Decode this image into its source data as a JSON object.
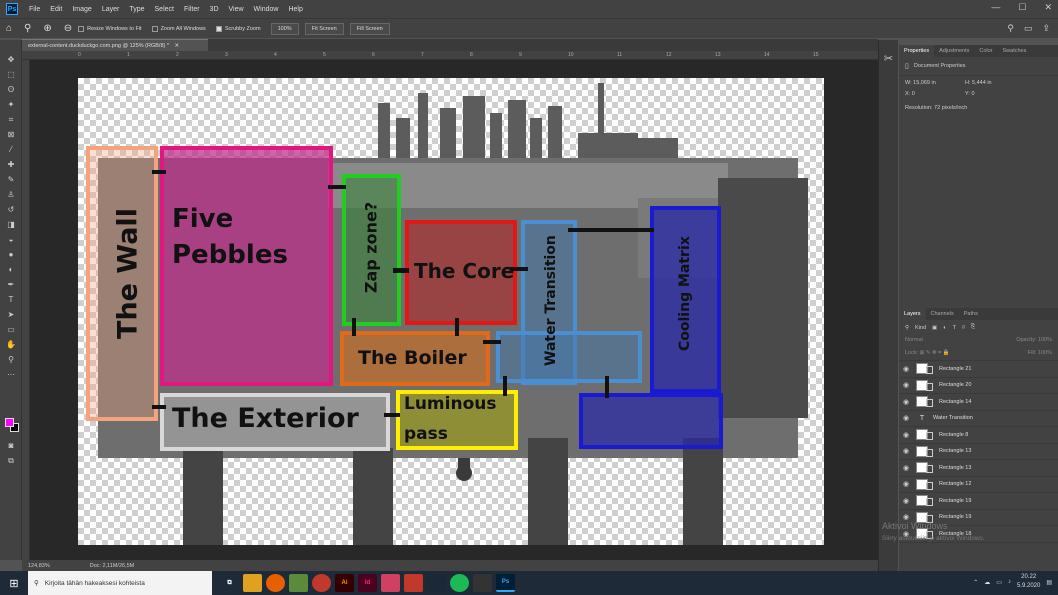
{
  "menubar": {
    "logo": "Ps",
    "items": [
      "File",
      "Edit",
      "Image",
      "Layer",
      "Type",
      "Select",
      "Filter",
      "3D",
      "View",
      "Window",
      "Help"
    ]
  },
  "options": {
    "resize_windows": "Resize Windows to Fit",
    "zoom_all": "Zoom All Windows",
    "scrubby_zoom": "Scrubby Zoom",
    "zoom_pct_btn": "100%",
    "fit_screen": "Fit Screen",
    "fill_screen": "Fill Screen"
  },
  "document": {
    "tab_title": "external-content.duckduckgo.com.png @ 125% (RGB/8) *"
  },
  "ruler": {
    "ticks": [
      "0",
      "1",
      "2",
      "3",
      "4",
      "5",
      "6",
      "7",
      "8",
      "9",
      "10",
      "11",
      "12",
      "13",
      "14",
      "15"
    ]
  },
  "map": {
    "labels": {
      "wall": "The Wall",
      "five_pebbles_1": "Five",
      "five_pebbles_2": "Pebbles",
      "zap": "Zap zone?",
      "core": "The Core",
      "water": "Water Transition",
      "cooling": "Cooling Matrix",
      "boiler": "The Boiler",
      "exterior": "The Exterior",
      "luminous_1": "Luminous",
      "luminous_2": "pass"
    },
    "colors": {
      "wall": "#f4a37d",
      "five_pebbles": "#e3157f",
      "zap": "#22cc22",
      "core": "#e01818",
      "water": "#4a8fd1",
      "cooling": "#1a1ad0",
      "boiler": "#e06a1a",
      "exterior": "#d8d8d8",
      "luminous": "#ffee00",
      "bottom_blue": "#1a1ad0"
    }
  },
  "status": {
    "zoom": "124,83%",
    "doc": "Doc: 2,11M/26,5M"
  },
  "properties": {
    "tabs": [
      "Properties",
      "Adjustments",
      "Color",
      "Swatches"
    ],
    "section": "Document Properties",
    "w_label": "W:",
    "w_value": "15,069 in",
    "h_label": "H:",
    "h_value": "5,444 in",
    "x_label": "X:",
    "x_value": "0",
    "y_label": "Y:",
    "y_value": "0",
    "resolution": "Resolution: 72 pixels/inch"
  },
  "layers": {
    "tabs": [
      "Layers",
      "Channels",
      "Paths"
    ],
    "kind": "Kind",
    "blend": "Normal",
    "opacity_label": "Opacity:",
    "opacity_value": "100%",
    "lock_label": "Lock:",
    "fill_label": "Fill:",
    "fill_value": "100%",
    "items": [
      {
        "name": "Rectangle 21",
        "type": "shape"
      },
      {
        "name": "Rectangle 20",
        "type": "shape"
      },
      {
        "name": "Rectangle 14",
        "type": "shape"
      },
      {
        "name": "Water Transition",
        "type": "text"
      },
      {
        "name": "Rectangle 8",
        "type": "shape"
      },
      {
        "name": "Rectangle 13",
        "type": "shape"
      },
      {
        "name": "Rectangle 13",
        "type": "shape"
      },
      {
        "name": "Rectangle 12",
        "type": "shape"
      },
      {
        "name": "Rectangle 19",
        "type": "shape"
      },
      {
        "name": "Rectangle 19",
        "type": "shape"
      },
      {
        "name": "Rectangle 18",
        "type": "shape"
      }
    ]
  },
  "watermark": {
    "line1": "Aktivoi Windows",
    "line2": "Siirry asetuksiin ja aktivoi Windows."
  },
  "taskbar": {
    "search_placeholder": "Kirjoita tähän hakeaksesi kohteista",
    "time": "20.22",
    "date": "5.9.2020",
    "apps": [
      {
        "label": "",
        "color": "#3a6ea5"
      },
      {
        "label": "",
        "color": "#e0a020"
      },
      {
        "label": "",
        "color": "#e66000"
      },
      {
        "label": "",
        "color": "#5a8a3a"
      },
      {
        "label": "",
        "color": "#c0392b"
      },
      {
        "label": "Ai",
        "color": "#330000"
      },
      {
        "label": "Id",
        "color": "#49021f"
      },
      {
        "label": "",
        "color": "#d04060"
      },
      {
        "label": "",
        "color": "#c0392b"
      },
      {
        "label": "",
        "color": "#1b2838"
      },
      {
        "label": "",
        "color": "#1db954"
      },
      {
        "label": "",
        "color": "#333"
      },
      {
        "label": "Ps",
        "color": "#001e36"
      }
    ]
  }
}
